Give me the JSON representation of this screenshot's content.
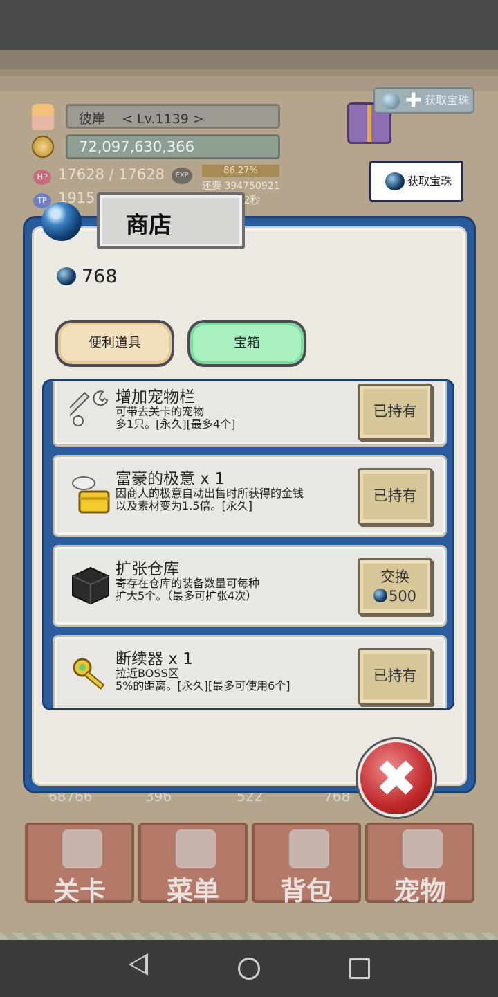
{
  "hud": {
    "player_name": "彼岸",
    "level": "< Lv.1139 >",
    "gold": "72,097,630,366",
    "hp_badge": "HP",
    "hp": "17628 / 17628",
    "exp_badge": "EXP",
    "exp_percent": "86.27%",
    "exp_needed": "还要 394750921",
    "tp_badge": "TP",
    "tp_partial": "1915",
    "timer_partial": "2秒",
    "get_gem_button": "获取宝珠",
    "gem_plus_button": "获取宝珠"
  },
  "shop": {
    "title": "商店",
    "gem_balance": "768",
    "tabs": [
      {
        "label": "便利道具",
        "active": false
      },
      {
        "label": "宝箱",
        "active": true
      }
    ],
    "items": [
      {
        "icon": "wrench-icon",
        "title": "增加宠物栏",
        "desc": "可带去关卡的宠物\n多1只。[永久][最多4个]",
        "button": "已持有"
      },
      {
        "icon": "treasure-chest-icon",
        "title": "富豪的极意 x 1",
        "desc": "因商人的极意自动出售时所获得的金钱\n以及素材变为1.5倍。[永久]",
        "button": "已持有"
      },
      {
        "icon": "cube-icon",
        "title": "扩张仓库",
        "desc": "寄存在仓库的装备数量可每种\n扩大5个。（最多可扩张4次）",
        "button": "交换",
        "price": "500"
      },
      {
        "icon": "key-icon",
        "title": "断续器 x 1",
        "desc": "拉近BOSS区\n5%的距离。[永久][最多可使用6个]",
        "button": "已持有"
      }
    ]
  },
  "resources": [
    "68766",
    "396",
    "522",
    "768"
  ],
  "bottom_nav": [
    "关卡",
    "菜单",
    "背包",
    "宠物"
  ],
  "colors": {
    "modal_frame": "#285b9b",
    "tab_active": "#a9f0c0",
    "tab_inactive": "#f2dfbc",
    "close_button": "#c0292b"
  }
}
